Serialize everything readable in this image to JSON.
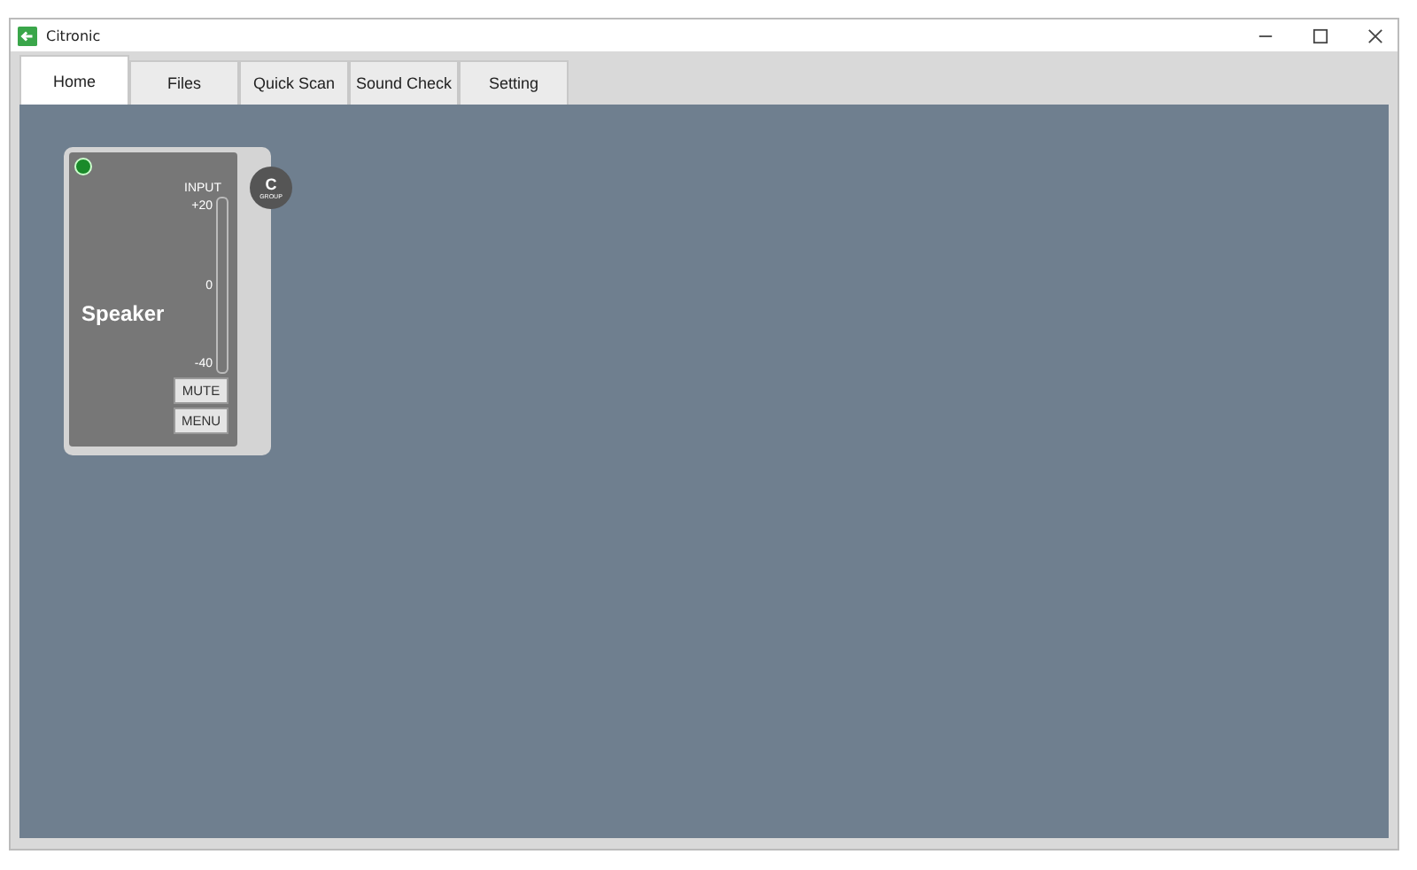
{
  "window": {
    "title": "Citronic"
  },
  "tabs": [
    {
      "label": "Home",
      "selected": true
    },
    {
      "label": "Files",
      "selected": false
    },
    {
      "label": "Quick Scan",
      "selected": false
    },
    {
      "label": "Sound Check",
      "selected": false
    },
    {
      "label": "Setting",
      "selected": false
    }
  ],
  "channel": {
    "name": "Speaker",
    "active": true,
    "meter_label": "INPUT",
    "scale": [
      "+20",
      "0",
      "-40"
    ],
    "buttons": [
      "MUTE",
      "MENU"
    ],
    "group": {
      "letter": "C",
      "label": "GROUP"
    }
  }
}
